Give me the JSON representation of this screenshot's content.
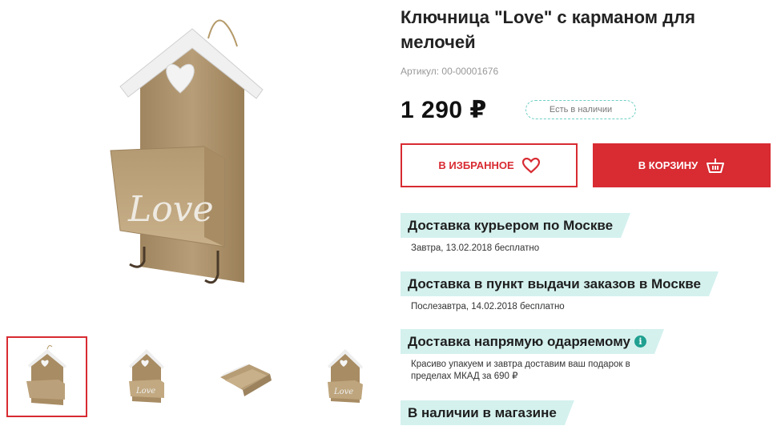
{
  "product": {
    "title": "Ключница \"Love\" с карманом для мелочей",
    "sku": "Артикул: 00-00001676",
    "price": "1 290 ₽",
    "stock": "Есть в наличии",
    "image_text": "Love"
  },
  "gallery": {
    "thumbs": [
      {
        "name": "thumb-1",
        "icon": "house-keyholder-front"
      },
      {
        "name": "thumb-2",
        "icon": "house-keyholder-front"
      },
      {
        "name": "thumb-3",
        "icon": "house-keyholder-flat"
      },
      {
        "name": "thumb-4",
        "icon": "house-keyholder-side"
      }
    ]
  },
  "actions": {
    "favorite_label": "В ИЗБРАННОЕ",
    "favorite_icon": "heart-icon",
    "cart_label": "В КОРЗИНУ",
    "cart_icon": "basket-icon"
  },
  "delivery": [
    {
      "title": "Доставка курьером по Москве",
      "desc": "Завтра, 13.02.2018 бесплатно"
    },
    {
      "title": "Доставка в пункт выдачи заказов в Москве",
      "desc": "Послезавтра, 14.02.2018 бесплатно"
    },
    {
      "title": "Доставка напрямую одаряемому",
      "desc": "Красиво упакуем и завтра доставим ваш подарок в пределах МКАД за 690 ₽",
      "info_icon": "i"
    },
    {
      "title": "В наличии в магазине",
      "desc": ""
    }
  ],
  "colors": {
    "accent": "#d82b32",
    "teal_bg": "#d4f1ee",
    "teal": "#20a090"
  }
}
